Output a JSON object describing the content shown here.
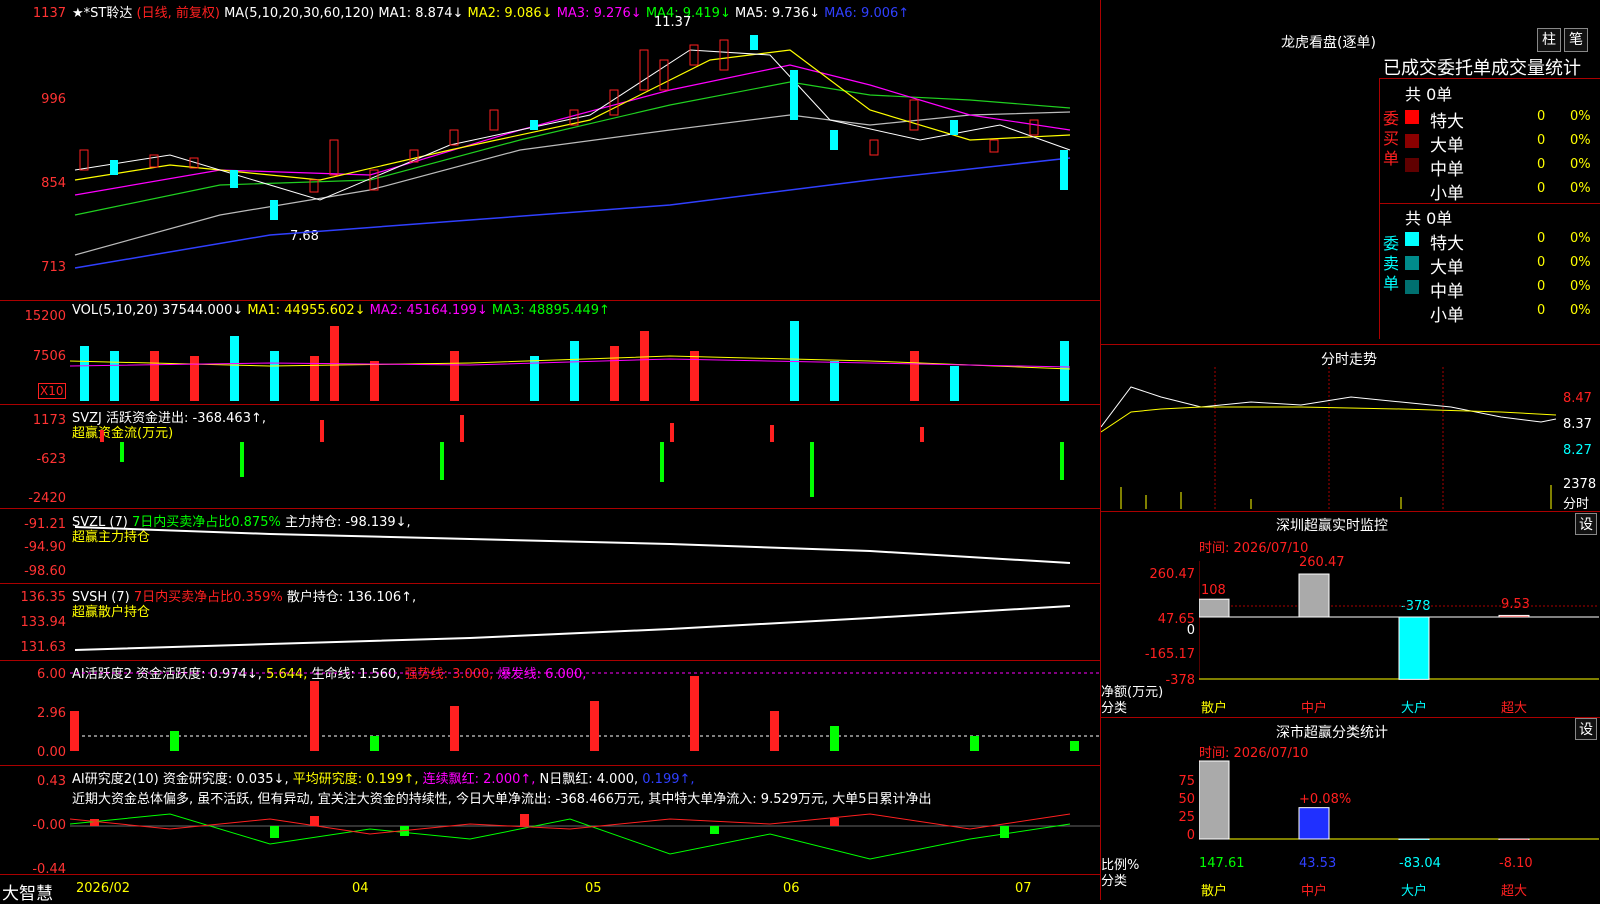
{
  "header": {
    "stock": "★*ST聆达",
    "mode": "(日线, 前复权)",
    "ma_params": "MA(5,10,20,30,60,120)",
    "ma1": "MA1: 8.874↓",
    "ma2": "MA2: 9.086↓",
    "ma3": "MA3: 9.276↓",
    "ma4": "MA4: 9.419↓",
    "ma5": "MA5: 9.736↓",
    "ma6": "MA6: 9.006↑",
    "high_mark": "11.37",
    "low_mark": "7.68"
  },
  "price_axis": [
    "1137",
    "996",
    "854",
    "713"
  ],
  "vol": {
    "title": "VOL(5,10,20)",
    "v": "37544.000↓",
    "ma1": "MA1: 44955.602↓",
    "ma2": "MA2: 45164.199↓",
    "ma3": "MA3: 48895.449↑",
    "axis": [
      "15200",
      "7506"
    ],
    "unit": "X10"
  },
  "svzj": {
    "line1": "SVZJ  活跃资金进出: -368.463↑,",
    "line2": "超赢资金流(万元)",
    "axis": [
      "1173",
      "-623",
      "-2420"
    ]
  },
  "svzl": {
    "title": "SVZL (7)",
    "ratio": "7日内买卖净占比0.875%",
    "hold": "主力持仓: -98.139↓,",
    "line2": "超赢主力持仓",
    "axis": [
      "-91.21",
      "-94.90",
      "-98.60"
    ]
  },
  "svsh": {
    "title": "SVSH (7)",
    "ratio": "7日内买卖净占比0.359%",
    "hold": "散户持仓: 136.106↑,",
    "line2": "超赢散户持仓",
    "axis": [
      "136.35",
      "133.94",
      "131.63"
    ]
  },
  "ai1": {
    "title": "AI活跃度2",
    "a": "资金活跃度: 0.974↓,",
    "b": "5.644,",
    "c": "生命线: 1.560,",
    "d": "强势线: 3.000,",
    "e": "爆发线: 6.000,",
    "axis": [
      "6.00",
      "2.96",
      "0.00"
    ]
  },
  "ai2": {
    "title": "AI研究度2(10)",
    "a": "资金研究度: 0.035↓,",
    "b": "平均研究度: 0.199↑,",
    "c": "连续飘红: 2.000↑,",
    "d": "N日飘红: 4.000,",
    "e": "0.199↑,",
    "text": "近期大资金总体偏多, 虽不活跃, 但有异动, 宜关注大资金的持续性, 今日大单净流出: -368.466万元, 其中特大单净流入: 9.529万元, 大单5日累计净出",
    "axis": [
      "0.43",
      "-0.00",
      "-0.44"
    ]
  },
  "bottom": {
    "brand": "大智慧",
    "months": [
      "2026/02",
      "04",
      "05",
      "06",
      "07"
    ]
  },
  "lhb": {
    "title": "龙虎看盘(逐单)",
    "btn1": "柱",
    "btn2": "笔",
    "header": "已成交委托单成交量统计",
    "buy_total": "共 0单",
    "sell_total": "共 0单",
    "buy_label": "委买单",
    "sell_label": "委卖单",
    "buy_rows": [
      {
        "name": "特大",
        "n": "0",
        "p": "0%",
        "color": "#ff0000"
      },
      {
        "name": "大单",
        "n": "0",
        "p": "0%",
        "color": "#8b0000"
      },
      {
        "name": "中单",
        "n": "0",
        "p": "0%",
        "color": "#600000"
      },
      {
        "name": "小单",
        "n": "0",
        "p": "0%",
        "color": "#000000"
      }
    ],
    "sell_rows": [
      {
        "name": "特大",
        "n": "0",
        "p": "0%",
        "color": "#00ffff"
      },
      {
        "name": "大单",
        "n": "0",
        "p": "0%",
        "color": "#008b8b"
      },
      {
        "name": "中单",
        "n": "0",
        "p": "0%",
        "color": "#007070"
      },
      {
        "name": "小单",
        "n": "0",
        "p": "0%",
        "color": "#000000"
      }
    ]
  },
  "fenshi": {
    "title": "分时走势",
    "axis": [
      "8.47",
      "8.37",
      "8.27"
    ],
    "vol": "2378",
    "vol_label": "分时"
  },
  "monitor": {
    "title": "深圳超赢实时监控",
    "btn": "设",
    "time": "时间: 2026/07/10",
    "axis": [
      "260.47",
      "47.65",
      "0",
      "-165.17",
      "-378"
    ],
    "ylabel": "净额(万元)",
    "xlabel": "分类",
    "categories": [
      "散户",
      "中户",
      "大户",
      "超大"
    ],
    "value_labels": [
      "108",
      "260.47",
      "-378",
      "9.53"
    ]
  },
  "classify": {
    "title": "深市超赢分类统计",
    "btn": "设",
    "time": "时间: 2026/07/10",
    "axis": [
      "75",
      "50",
      "25",
      "0"
    ],
    "ylabel": "比例%",
    "xlabel": "分类",
    "categories": [
      "散户",
      "中户",
      "大户",
      "超大"
    ],
    "values": [
      "147.61",
      "43.53",
      "-83.04",
      "-8.10"
    ],
    "annotation": "+0.08%"
  },
  "chart_data": [
    {
      "type": "bar",
      "title": "深圳超赢实时监控",
      "ylabel": "净额(万元)",
      "categories": [
        "散户",
        "中户",
        "大户",
        "超大"
      ],
      "values": [
        108,
        260.47,
        -378,
        9.53
      ],
      "ylim": [
        -378,
        260.47
      ]
    },
    {
      "type": "bar",
      "title": "深市超赢分类统计",
      "ylabel": "比例%",
      "categories": [
        "散户",
        "中户",
        "大户",
        "超大"
      ],
      "values": [
        147.61,
        43.53,
        -83.04,
        -8.1
      ],
      "ylim": [
        0,
        75
      ]
    }
  ]
}
